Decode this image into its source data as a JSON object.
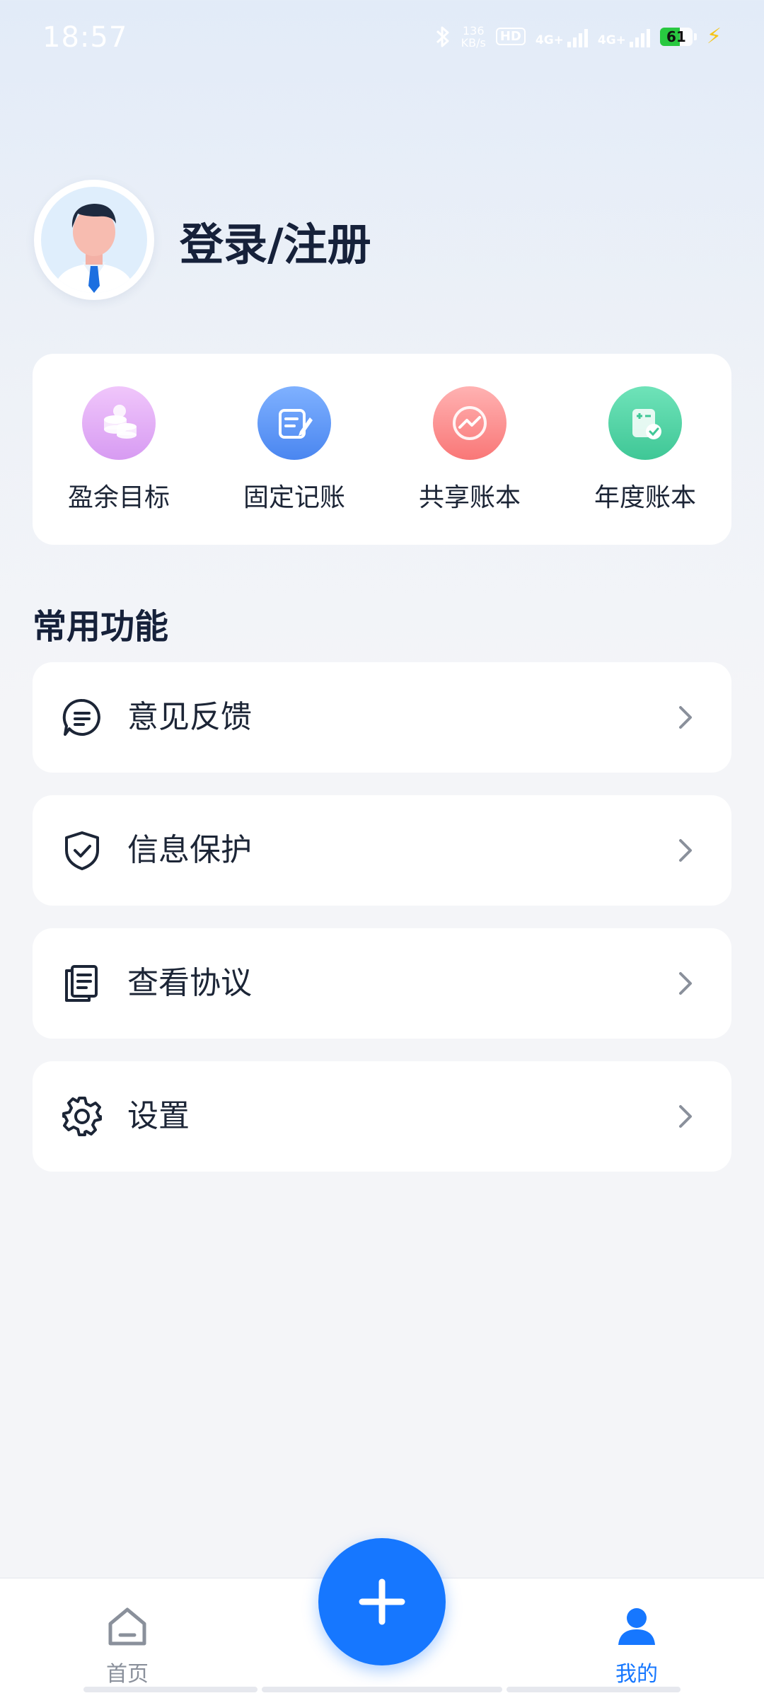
{
  "status_bar": {
    "time": "18:57",
    "net_speed": "136",
    "net_speed_unit": "KB/s",
    "hd": "HD",
    "network_1": "4G+",
    "network_2": "4G+",
    "battery": "61",
    "colors": {
      "battery_fill": "#28c840",
      "charging": "#f5c518"
    }
  },
  "profile": {
    "avatar_icon": "avatar-man-icon",
    "login_text": "登录/注册"
  },
  "quick_actions": [
    {
      "label": "盈余目标",
      "icon": "coins-icon",
      "color": "#dba8f6"
    },
    {
      "label": "固定记账",
      "icon": "notebook-pen-icon",
      "color": "#5b95f4"
    },
    {
      "label": "共享账本",
      "icon": "chart-trend-icon",
      "color": "#fb8e8e"
    },
    {
      "label": "年度账本",
      "icon": "calculator-icon",
      "color": "#4fd7a8"
    }
  ],
  "section": {
    "title": "常用功能"
  },
  "menu": [
    {
      "label": "意见反馈",
      "icon": "feedback-icon"
    },
    {
      "label": "信息保护",
      "icon": "shield-check-icon"
    },
    {
      "label": "查看协议",
      "icon": "document-icon"
    },
    {
      "label": "设置",
      "icon": "gear-icon"
    }
  ],
  "bottom_nav": {
    "home": {
      "label": "首页",
      "icon": "home-icon"
    },
    "add": {
      "icon": "plus-icon"
    },
    "mine": {
      "label": "我的",
      "icon": "user-icon"
    }
  },
  "colors": {
    "accent": "#1677ff",
    "text_primary": "#1c2536",
    "inactive": "#8a909b"
  }
}
